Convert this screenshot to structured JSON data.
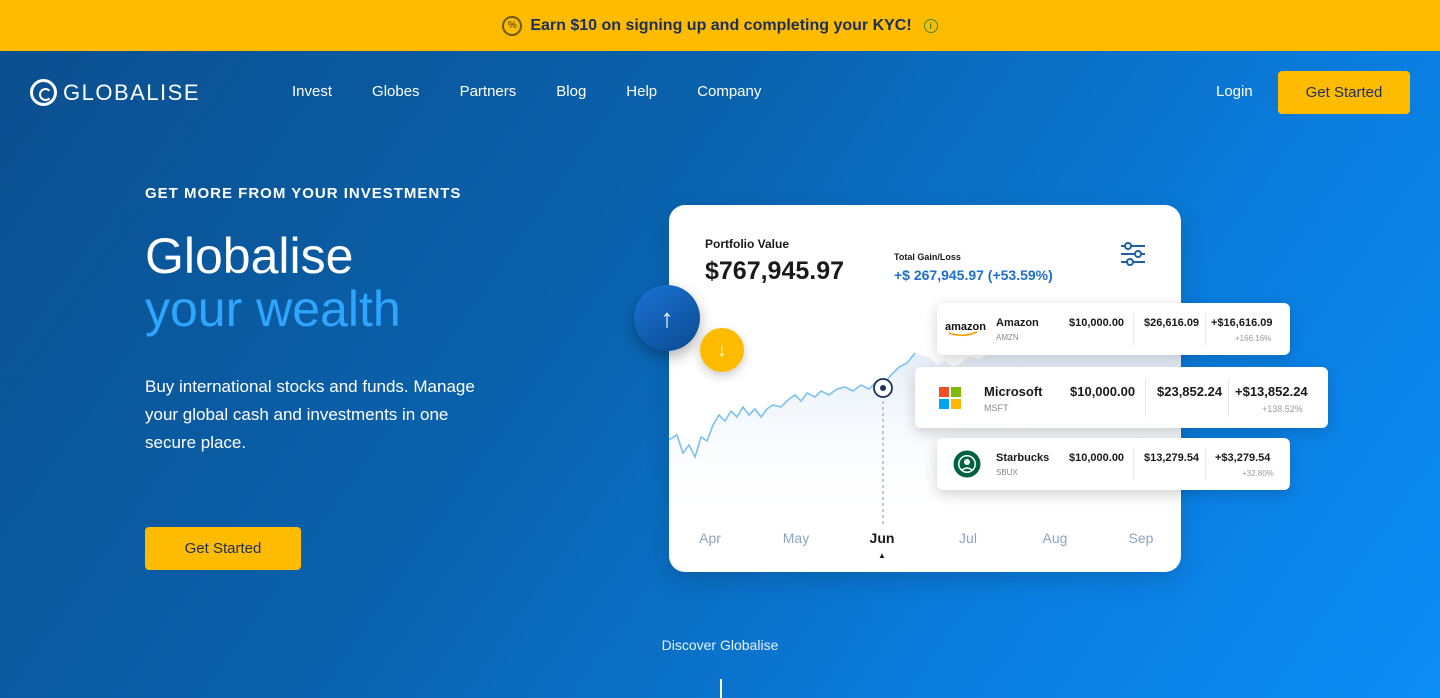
{
  "promo": {
    "text": "Earn $10 on signing up and completing your KYC!",
    "badge_icon": "percent-badge-icon",
    "info_icon": "info-icon"
  },
  "nav": {
    "brand": "GLOBALISE",
    "links": [
      "Invest",
      "Globes",
      "Partners",
      "Blog",
      "Help",
      "Company"
    ],
    "login": "Login",
    "cta": "Get Started"
  },
  "hero": {
    "eyebrow": "GET MORE FROM YOUR INVESTMENTS",
    "title_line1": "Globalise",
    "title_line2": "your wealth",
    "description": "Buy international stocks and funds. Manage your global cash and investments in one secure place.",
    "cta": "Get Started",
    "discover": "Discover Globalise"
  },
  "portfolio": {
    "label": "Portfolio Value",
    "value": "$767,945.97",
    "gain_label": "Total Gain/Loss",
    "gain_value": "+$ 267,945.97 (+53.59%)",
    "months": [
      "Apr",
      "May",
      "Jun",
      "Jul",
      "Aug",
      "Sep"
    ],
    "active_month": "Jun"
  },
  "holdings": [
    {
      "name": "Amazon",
      "ticker": "AMZN",
      "invested": "$10,000.00",
      "current": "$26,616.09",
      "gain": "+$16,616.09",
      "pct": "+166.16%"
    },
    {
      "name": "Microsoft",
      "ticker": "MSFT",
      "invested": "$10,000.00",
      "current": "$23,852.24",
      "gain": "+$13,852.24",
      "pct": "+138.52%"
    },
    {
      "name": "Starbucks",
      "ticker": "SBUX",
      "invested": "$10,000.00",
      "current": "$13,279.54",
      "gain": "+$3,279.54",
      "pct": "+32.80%"
    }
  ],
  "colors": {
    "accent_yellow": "#ffbb00",
    "accent_blue": "#2ea5ff",
    "gain_blue": "#1d6fc9"
  }
}
